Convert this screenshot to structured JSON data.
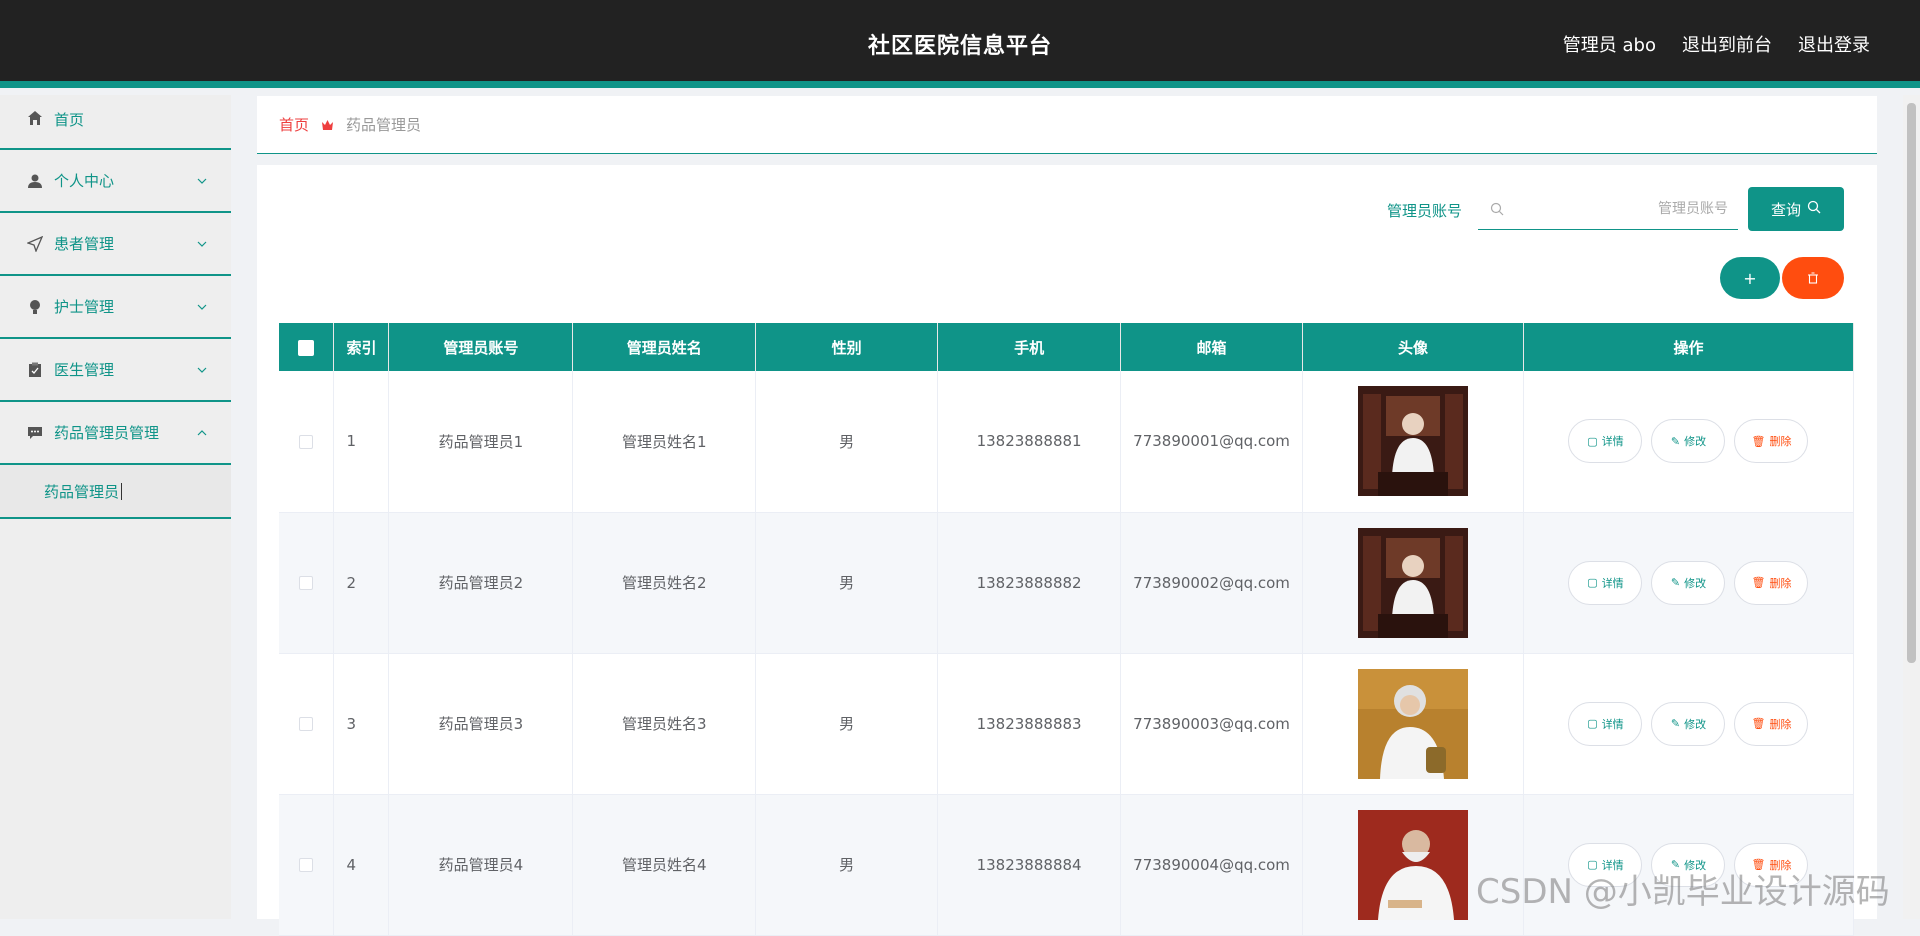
{
  "header": {
    "title": "社区医院信息平台",
    "user": "管理员 abo",
    "to_front": "退出到前台",
    "logout": "退出登录"
  },
  "sidebar": {
    "items": [
      {
        "label": "首页",
        "icon": "home-icon"
      },
      {
        "label": "个人中心",
        "icon": "user-icon"
      },
      {
        "label": "患者管理",
        "icon": "send-icon"
      },
      {
        "label": "护士管理",
        "icon": "bulb-icon"
      },
      {
        "label": "医生管理",
        "icon": "clipboard-icon"
      },
      {
        "label": "药品管理员管理",
        "icon": "chat-icon"
      }
    ],
    "sub_item": "药品管理员"
  },
  "breadcrumb": {
    "home": "首页",
    "current": "药品管理员"
  },
  "search": {
    "label": "管理员账号",
    "placeholder": "管理员账号",
    "button": "查询"
  },
  "actions": {
    "add": "+"
  },
  "table": {
    "headers": [
      "索引",
      "管理员账号",
      "管理员姓名",
      "性别",
      "手机",
      "邮箱",
      "头像",
      "操作"
    ],
    "rows": [
      {
        "index": "1",
        "account": "药品管理员1",
        "name": "管理员姓名1",
        "gender": "男",
        "phone": "13823888881",
        "email": "773890001@qq.com"
      },
      {
        "index": "2",
        "account": "药品管理员2",
        "name": "管理员姓名2",
        "gender": "男",
        "phone": "13823888882",
        "email": "773890002@qq.com"
      },
      {
        "index": "3",
        "account": "药品管理员3",
        "name": "管理员姓名3",
        "gender": "男",
        "phone": "13823888883",
        "email": "773890003@qq.com"
      },
      {
        "index": "4",
        "account": "药品管理员4",
        "name": "管理员姓名4",
        "gender": "男",
        "phone": "13823888884",
        "email": "773890004@qq.com"
      }
    ],
    "ops": {
      "detail": "详情",
      "edit": "修改",
      "delete": "删除"
    }
  },
  "watermark": "CSDN @小凯毕业设计源码",
  "colors": {
    "accent": "#0f9488",
    "danger": "#ff4d0f",
    "header_bg": "#222222"
  }
}
